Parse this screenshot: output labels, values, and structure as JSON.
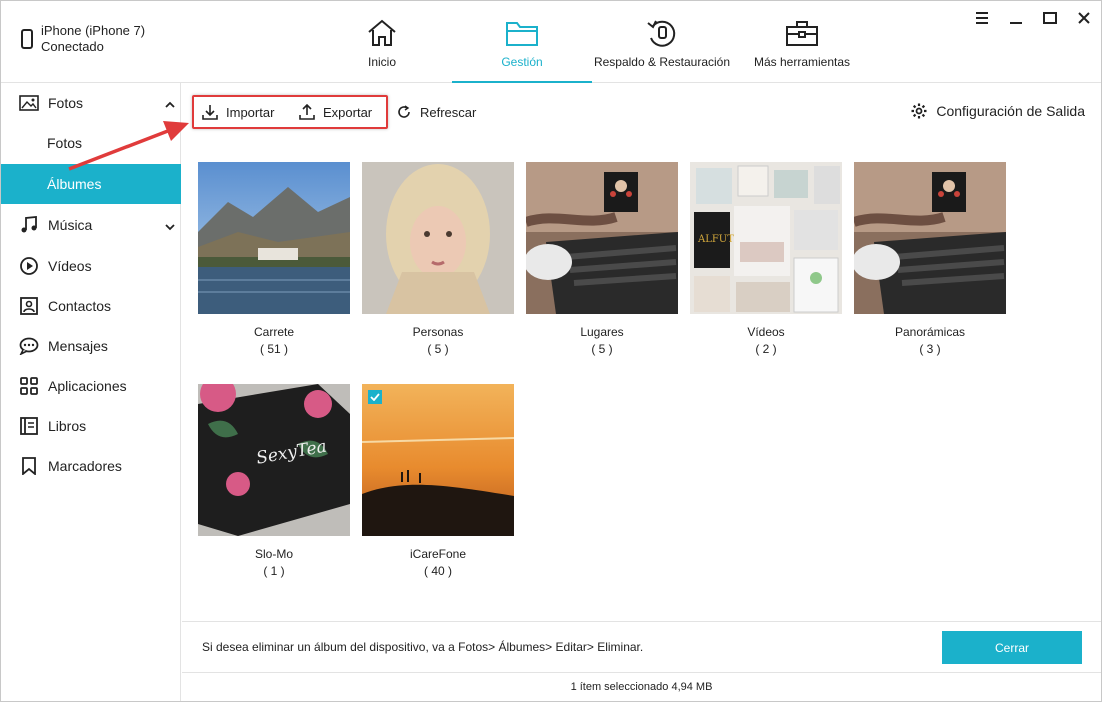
{
  "device": {
    "name": "iPhone (iPhone 7)",
    "status": "Conectado"
  },
  "nav": [
    {
      "label": "Inicio",
      "icon": "home-icon"
    },
    {
      "label": "Gestión",
      "icon": "folder-icon"
    },
    {
      "label": "Respaldo & Restauración",
      "icon": "backup-restore-icon"
    },
    {
      "label": "Más herramientas",
      "icon": "toolbox-icon"
    }
  ],
  "sidebar": {
    "fotos": "Fotos",
    "fotos_sub": "Fotos",
    "albumes_sub": "Álbumes",
    "items": [
      "Música",
      "Vídeos",
      "Contactos",
      "Mensajes",
      "Aplicaciones",
      "Libros",
      "Marcadores"
    ]
  },
  "toolbar": {
    "import_label": "Importar",
    "export_label": "Exportar",
    "refresh_label": "Refrescar",
    "settings_label": "Configuración de Salida"
  },
  "albums": [
    {
      "name": "Carrete",
      "count": "( 51 )"
    },
    {
      "name": "Personas",
      "count": "( 5 )"
    },
    {
      "name": "Lugares",
      "count": "( 5 )"
    },
    {
      "name": "Vídeos",
      "count": "( 2 )"
    },
    {
      "name": "Panorámicas",
      "count": "( 3 )"
    },
    {
      "name": "Slo-Mo",
      "count": "( 1 )"
    },
    {
      "name": "iCareFone",
      "count": "( 40 )"
    }
  ],
  "footer": {
    "message": "Si desea eliminar un álbum del dispositivo, va a Fotos> Álbumes> Editar> Eliminar.",
    "close_label": "Cerrar",
    "status": "1 ítem seleccionado 4,94 MB"
  },
  "colors": {
    "accent": "#1bb1cb",
    "highlight": "#e03b3b"
  }
}
